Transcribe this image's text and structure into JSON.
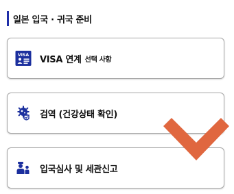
{
  "section": {
    "title": "일본 입국 · 귀국 준비"
  },
  "cards": [
    {
      "label": "VISA 연계",
      "sub": "선택 사항",
      "icon": "visa-card-icon",
      "icon_text": "VISA"
    },
    {
      "label": "검역 (건강상태 확인)",
      "icon": "quarantine-icon"
    },
    {
      "label": "입국심사 및 세관신고",
      "icon": "immigration-officer-icon"
    }
  ],
  "overlay": {
    "icon": "chevron-down-icon"
  },
  "colors": {
    "accent": "#1f2ea8",
    "icon_blue": "#1b2f9e",
    "chevron": "#e0673f",
    "border": "#a8a8a8"
  }
}
